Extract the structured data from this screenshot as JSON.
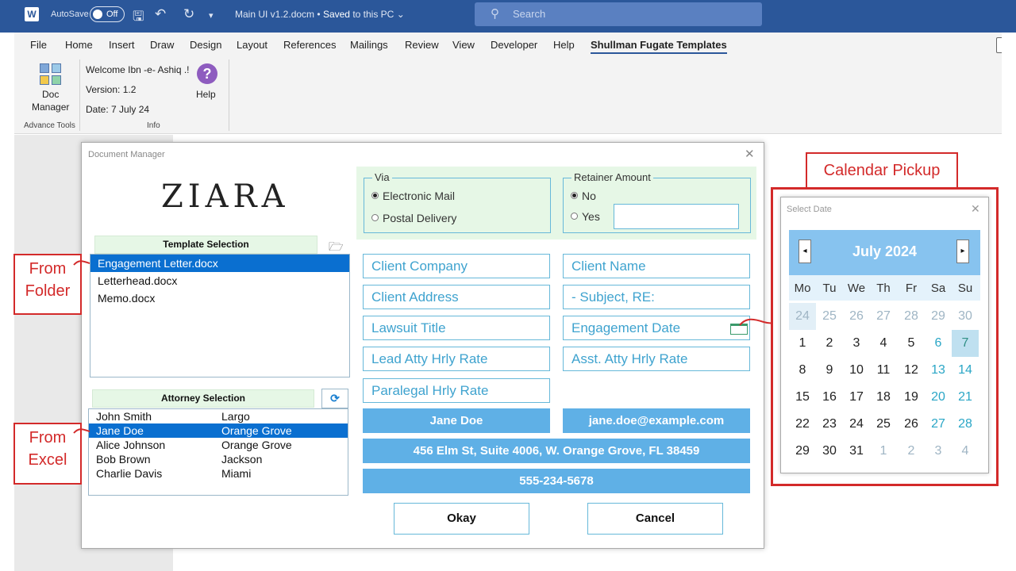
{
  "titlebar": {
    "autosave_label": "AutoSave",
    "autosave_state": "Off",
    "doc_name": "Main UI v1.2.docm",
    "save_state": "Saved",
    "save_location": "to this PC",
    "search_placeholder": "Search"
  },
  "menu": [
    "File",
    "Home",
    "Insert",
    "Draw",
    "Design",
    "Layout",
    "References",
    "Mailings",
    "Review",
    "View",
    "Developer",
    "Help",
    "Shullman Fugate Templates"
  ],
  "ribbon": {
    "doc_manager_line1": "Doc",
    "doc_manager_line2": "Manager",
    "welcome": "Welcome Ibn -e- Ashiq .!",
    "version": "Version: 1.2",
    "date": "Date: 7 July 24",
    "help": "Help",
    "group_advance": "Advance Tools",
    "group_info": "Info"
  },
  "dialog": {
    "title": "Document Manager",
    "logo": "ZIARA",
    "template_header": "Template Selection",
    "templates": [
      "Engagement Letter.docx",
      "Letterhead.docx",
      "Memo.docx"
    ],
    "attorney_header": "Attorney Selection",
    "attorneys": [
      {
        "name": "John Smith",
        "city": "Largo"
      },
      {
        "name": "Jane Doe",
        "city": "Orange Grove"
      },
      {
        "name": "Alice Johnson",
        "city": "Orange Grove"
      },
      {
        "name": "Bob Brown",
        "city": "Jackson"
      },
      {
        "name": "Charlie Davis",
        "city": "Miami"
      }
    ],
    "via_label": "Via",
    "via_options": [
      "Electronic Mail",
      "Postal Delivery"
    ],
    "retainer_label": "Retainer Amount",
    "retainer_options": [
      "No",
      "Yes"
    ],
    "fields": {
      "client_company": "Client Company",
      "client_name": "Client Name",
      "client_address": "Client Address",
      "subject": "- Subject, RE:",
      "lawsuit_title": "Lawsuit Title",
      "engagement_date": "Engagement Date",
      "lead_rate": "Lead Atty Hrly Rate",
      "asst_rate": "Asst. Atty Hrly Rate",
      "paralegal_rate": "Paralegal Hrly Rate"
    },
    "attorney_name": "Jane Doe",
    "attorney_email": "jane.doe@example.com",
    "attorney_address": "456 Elm St, Suite 4006, W. Orange Grove, FL  38459",
    "attorney_phone": "555-234-5678",
    "okay": "Okay",
    "cancel": "Cancel"
  },
  "callouts": {
    "folder_line1": "From",
    "folder_line2": "Folder",
    "excel_line1": "From",
    "excel_line2": "Excel",
    "calendar": "Calendar Pickup"
  },
  "calendar": {
    "title": "Select Date",
    "month": "July 2024",
    "prev": "◂",
    "next": "▸",
    "weekdays": [
      "Mo",
      "Tu",
      "We",
      "Th",
      "Fr",
      "Sa",
      "Su"
    ],
    "weeks": [
      [
        "24",
        "25",
        "26",
        "27",
        "28",
        "29",
        "30"
      ],
      [
        "1",
        "2",
        "3",
        "4",
        "5",
        "6",
        "7"
      ],
      [
        "8",
        "9",
        "10",
        "11",
        "12",
        "13",
        "14"
      ],
      [
        "15",
        "16",
        "17",
        "18",
        "19",
        "20",
        "21"
      ],
      [
        "22",
        "23",
        "24",
        "25",
        "26",
        "27",
        "28"
      ],
      [
        "29",
        "30",
        "31",
        "1",
        "2",
        "3",
        "4"
      ]
    ]
  },
  "colors": {
    "word_blue": "#2b579a",
    "selection_blue": "#0a6fd0",
    "field_text": "#3fa3cf",
    "info_bar": "#5fb0e6",
    "callout_red": "#d32a2a"
  }
}
